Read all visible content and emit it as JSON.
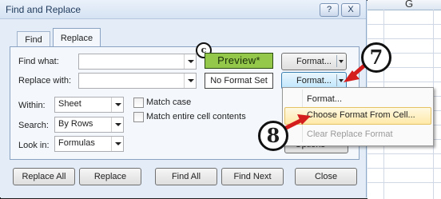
{
  "window": {
    "title": "Find and Replace"
  },
  "titlebar_buttons": {
    "help": "?",
    "close": "X"
  },
  "spreadsheet": {
    "column_label": "G"
  },
  "tabs": [
    {
      "label": "Find"
    },
    {
      "label": "Replace"
    }
  ],
  "find_what": {
    "label": "Find what:",
    "value": ""
  },
  "replace_with": {
    "label": "Replace with:",
    "value": ""
  },
  "callout_c": "c",
  "preview_label": "Preview*",
  "no_format_label": "No Format Set",
  "format_button_label": "Format...",
  "options": {
    "within": {
      "label": "Within:",
      "value": "Sheet"
    },
    "search": {
      "label": "Search:",
      "value": "By Rows"
    },
    "look_in": {
      "label": "Look in:",
      "value": "Formulas"
    },
    "match_case": "Match case",
    "match_entire": "Match entire cell contents",
    "options_button": "Options <<"
  },
  "format_menu": {
    "items": [
      "Format...",
      "Choose Format From Cell...",
      "Clear Replace Format"
    ]
  },
  "step_callouts": {
    "step7": "7",
    "step8": "8"
  },
  "buttons": {
    "replace_all": "Replace All",
    "replace": "Replace",
    "find_all": "Find All",
    "find_next": "Find Next",
    "close": "Close"
  },
  "colors": {
    "preview_bg": "#94c84a",
    "arrow": "#d41e1e",
    "menu_highlight": "#ffe9a8"
  }
}
